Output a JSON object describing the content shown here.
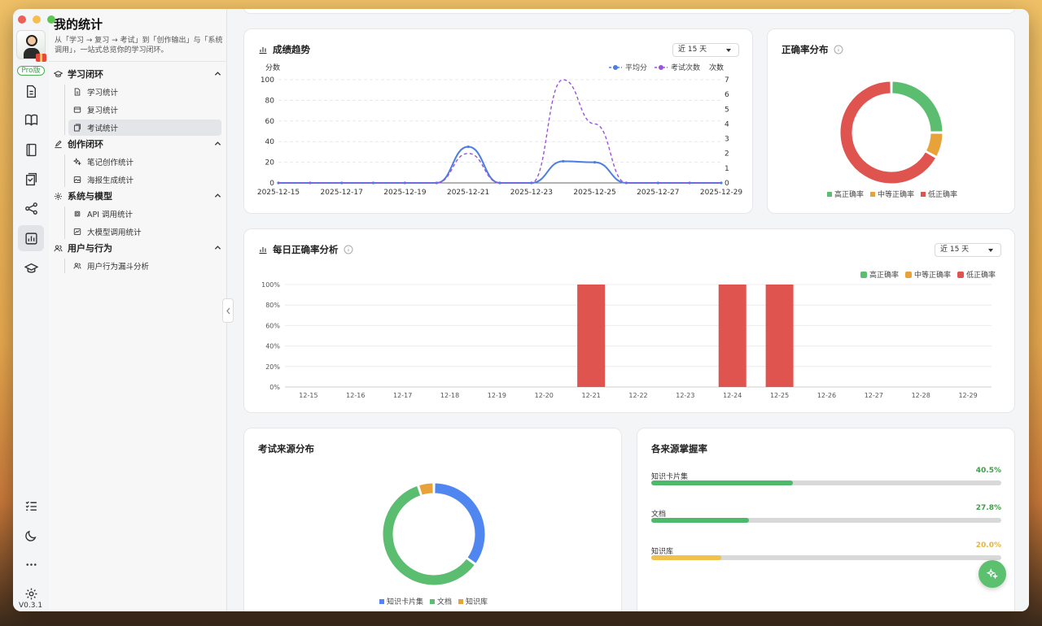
{
  "app": {
    "version": "V0.3.1",
    "pro_badge": "Pro版"
  },
  "sidebar": {
    "title": "我的统计",
    "description": "从「学习 → 复习 → 考试」到「创作输出」与「系统调用」，一站式总览你的学习闭环。",
    "groups": [
      {
        "label": "学习闭环",
        "items": [
          {
            "label": "学习统计"
          },
          {
            "label": "复习统计"
          },
          {
            "label": "考试统计"
          }
        ]
      },
      {
        "label": "创作闭环",
        "items": [
          {
            "label": "笔记创作统计"
          },
          {
            "label": "海报生成统计"
          }
        ]
      },
      {
        "label": "系统与模型",
        "items": [
          {
            "label": "API 调用统计"
          },
          {
            "label": "大模型调用统计"
          }
        ]
      },
      {
        "label": "用户与行为",
        "items": [
          {
            "label": "用户行为漏斗分析"
          }
        ]
      }
    ]
  },
  "score_trend": {
    "title": "成绩趋势",
    "range": "近 15 天",
    "ylabel_left": "分数",
    "ylabel_right": "次数",
    "legend": [
      "平均分",
      "考试次数"
    ]
  },
  "accuracy_dist": {
    "title": "正确率分布",
    "legend": [
      "高正确率",
      "中等正确率",
      "低正确率"
    ]
  },
  "daily_accuracy": {
    "title": "每日正确率分析",
    "range": "近 15 天",
    "legend": [
      "高正确率",
      "中等正确率",
      "低正确率"
    ]
  },
  "exam_source": {
    "title": "考试来源分布",
    "legend": [
      "知识卡片集",
      "文档",
      "知识库"
    ]
  },
  "mastery": {
    "title": "各来源掌握率",
    "items": [
      {
        "label": "知识卡片集",
        "value": "40.5%",
        "ratio": 0.405,
        "color": "#4cb96b"
      },
      {
        "label": "文档",
        "value": "27.8%",
        "ratio": 0.278,
        "color": "#4cb96b"
      },
      {
        "label": "知识库",
        "value": "20.0%",
        "ratio": 0.2,
        "color": "#f0c24b"
      }
    ]
  },
  "colors": {
    "high": "#5bbd6f",
    "mid": "#e8a23a",
    "low": "#e05450",
    "avg": "#4a7fe0",
    "count": "#9b53d9",
    "src_cards": "#4f86ef",
    "src_docs": "#5bbd6f",
    "src_kb": "#e8a23a"
  },
  "chart_data": [
    {
      "type": "line",
      "title": "成绩趋势",
      "x": [
        "2025-12-15",
        "2025-12-16",
        "2025-12-17",
        "2025-12-18",
        "2025-12-19",
        "2025-12-20",
        "2025-12-21",
        "2025-12-22",
        "2025-12-23",
        "2025-12-24",
        "2025-12-25",
        "2025-12-26",
        "2025-12-27",
        "2025-12-28",
        "2025-12-29"
      ],
      "x_tick_labels": [
        "2025-12-15",
        "2025-12-17",
        "2025-12-19",
        "2025-12-21",
        "2025-12-23",
        "2025-12-25",
        "2025-12-27",
        "2025-12-29"
      ],
      "ylabel": "分数",
      "ylim": [
        0,
        100
      ],
      "y_ticks": [
        0,
        20,
        40,
        60,
        80,
        100
      ],
      "y2label": "次数",
      "y2lim": [
        0,
        7
      ],
      "y2_ticks": [
        0,
        1,
        2,
        3,
        4,
        5,
        6,
        7
      ],
      "series": [
        {
          "name": "平均分",
          "axis": "left",
          "values": [
            0,
            0,
            0,
            0,
            0,
            0,
            35,
            0,
            0,
            21,
            20,
            0,
            0,
            0,
            0
          ]
        },
        {
          "name": "考试次数",
          "axis": "right",
          "values": [
            0,
            0,
            0,
            0,
            0,
            0,
            2,
            0,
            0,
            7,
            4,
            0,
            0,
            0,
            0
          ]
        }
      ]
    },
    {
      "type": "pie",
      "title": "正确率分布",
      "labels": [
        "高正确率",
        "中等正确率",
        "低正确率"
      ],
      "values": [
        25,
        8,
        67
      ]
    },
    {
      "type": "bar",
      "title": "每日正确率分析",
      "categories": [
        "12-15",
        "12-16",
        "12-17",
        "12-18",
        "12-19",
        "12-20",
        "12-21",
        "12-22",
        "12-23",
        "12-24",
        "12-25",
        "12-26",
        "12-27",
        "12-28",
        "12-29"
      ],
      "y_ticks": [
        "0%",
        "20%",
        "40%",
        "60%",
        "80%",
        "100%"
      ],
      "ylim": [
        0,
        100
      ],
      "stacked": true,
      "series": [
        {
          "name": "高正确率",
          "values": [
            0,
            0,
            0,
            0,
            0,
            0,
            0,
            0,
            0,
            0,
            0,
            0,
            0,
            0,
            0
          ]
        },
        {
          "name": "中等正确率",
          "values": [
            0,
            0,
            0,
            0,
            0,
            0,
            0,
            0,
            0,
            0,
            0,
            0,
            0,
            0,
            0
          ]
        },
        {
          "name": "低正确率",
          "values": [
            0,
            0,
            0,
            0,
            0,
            0,
            100,
            0,
            0,
            100,
            100,
            0,
            0,
            0,
            0
          ]
        }
      ]
    },
    {
      "type": "pie",
      "title": "考试来源分布",
      "labels": [
        "知识卡片集",
        "文档",
        "知识库"
      ],
      "values": [
        35,
        60,
        5
      ]
    }
  ]
}
